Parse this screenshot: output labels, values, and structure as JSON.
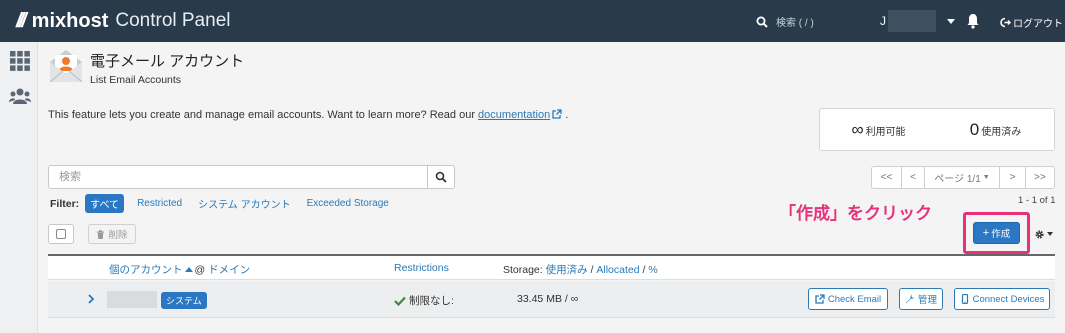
{
  "brand": {
    "mark": "///",
    "name": "mixhost",
    "sub": "Control Panel"
  },
  "topbar": {
    "search_placeholder": "検索 ( / )",
    "user_initial": "J",
    "logout_label": "ログアウト"
  },
  "header": {
    "title": "電子メール アカウント",
    "subtitle": "List Email Accounts"
  },
  "description": {
    "text": "This feature lets you create and manage email accounts. Want to learn more? Read our ",
    "link": "documentation",
    "tail": "."
  },
  "stats": {
    "available_value": "∞",
    "available_label": "利用可能",
    "used_value": "0",
    "used_label": "使用済み"
  },
  "search": {
    "placeholder": "検索"
  },
  "pager": {
    "first": "<<",
    "prev": "<",
    "page": "ページ 1/1",
    "next": ">",
    "last": ">>",
    "count": "1 - 1 of 1"
  },
  "filter": {
    "label": "Filter:",
    "chips": [
      "すべて",
      "Restricted",
      "システム アカウント",
      "Exceeded Storage"
    ]
  },
  "actions": {
    "delete_label": "削除",
    "create_label": "作成"
  },
  "annotation": "「作成」をクリック",
  "table": {
    "col_account": "個のアカウント",
    "col_at": "@",
    "col_domain": "ドメイン",
    "col_restrictions": "Restrictions",
    "col_storage_prefix": "Storage:",
    "col_used": "使用済み",
    "sep1": "/",
    "col_allocated": "Allocated",
    "sep2": "/",
    "col_percent": "%",
    "rows": [
      {
        "badge": "システム",
        "restrictions": "制限なし:",
        "storage": "33.45 MB / ∞",
        "check_email": "Check Email",
        "manage": "管理",
        "connect": "Connect Devices"
      }
    ]
  },
  "colors": {
    "accent": "#2a78c4",
    "topbar": "#293a4a",
    "annotation": "#e8317a"
  }
}
